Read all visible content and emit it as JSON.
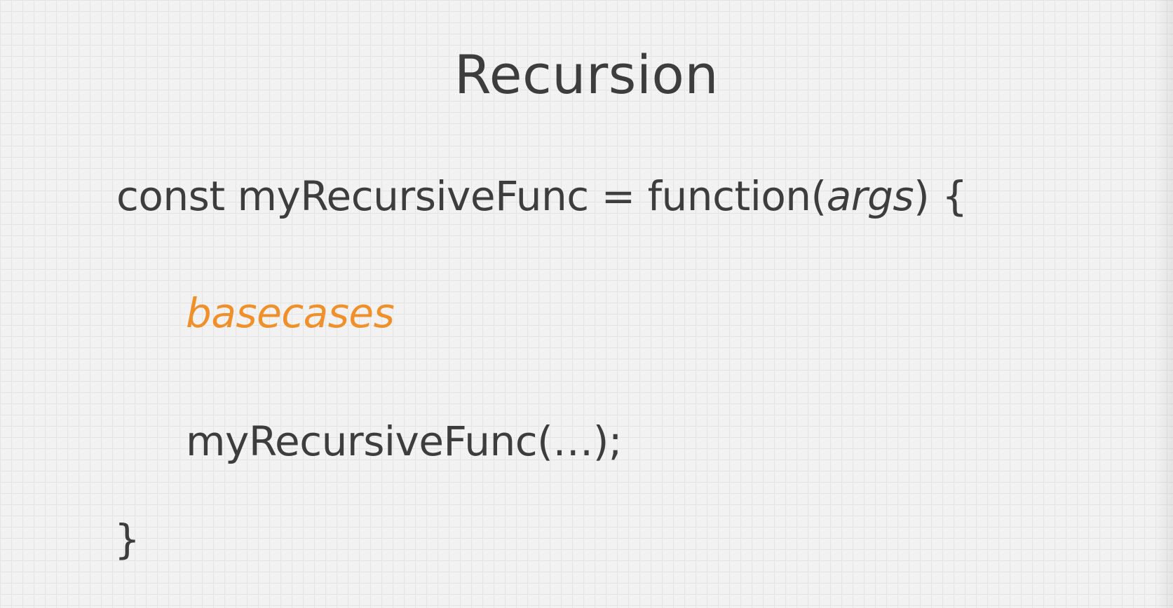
{
  "slide": {
    "title": "Recursion",
    "code": {
      "line1": {
        "prefix": "const myRecursiveFunc = function(",
        "arg": "args",
        "suffix": ") {"
      },
      "line2": "basecases",
      "line3": "myRecursiveFunc(…);",
      "line4": "}"
    }
  },
  "colors": {
    "background": "#f2f2f2",
    "text": "#3d3d3d",
    "accent": "#f0902a"
  }
}
